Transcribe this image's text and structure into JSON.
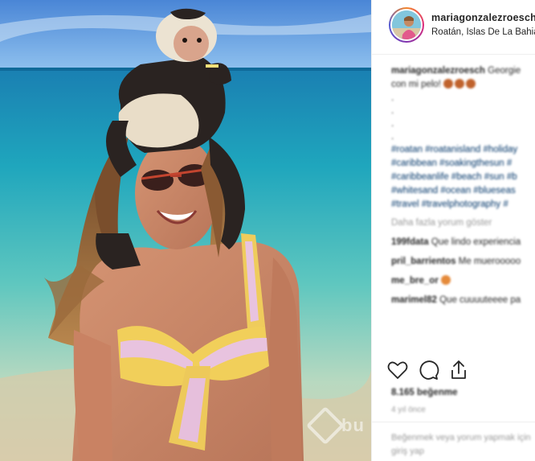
{
  "post": {
    "username": "mariagonzalezroesch",
    "location": "Roatán, Islas De La Bahia,",
    "watermark": "bu"
  },
  "caption": {
    "user": "mariagonzalezroesch",
    "text": "Georgie",
    "text2": "con mi pelo!",
    "hashtag_lines": [
      "#roatan #roatanisland #holiday",
      "#caribbean #soakingthesun #",
      "#caribbeanlife #beach #sun #b",
      "#whitesand #ocean #blueseas",
      "#travel #travelphotography #"
    ],
    "see_translation": "Daha fazla yorum göster"
  },
  "comments": [
    {
      "user": "199fdata",
      "text": "Que lindo experiencia"
    },
    {
      "user": "pril_barrientos",
      "text": "Me muerooooo"
    },
    {
      "user": "me_bre_or",
      "text": ""
    },
    {
      "user": "marimel82",
      "text": "Que cuuuuteeee pa"
    }
  ],
  "actions": {
    "like_icon": "heart-icon",
    "comment_icon": "comment-bubble-icon",
    "share_icon": "share-icon"
  },
  "likes": "8.165 beğenme",
  "time": "4 yıl önce",
  "add_comment": "Beğenmek veya yorum yapmak için giriş yap"
}
